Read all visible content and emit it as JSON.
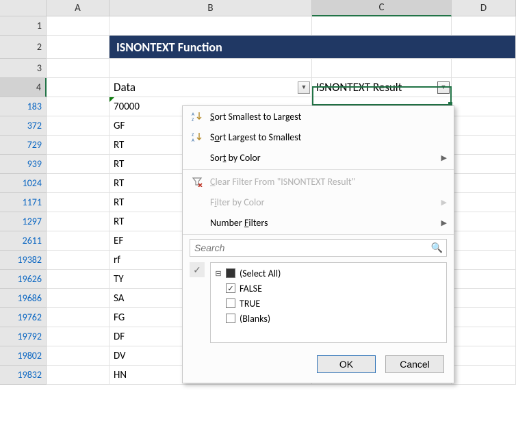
{
  "columns": {
    "A": "A",
    "B": "B",
    "C": "C",
    "D": "D"
  },
  "title_banner": "ISNONTEXT Function",
  "headers": {
    "data": "Data",
    "result": "ISNONTEXT Result"
  },
  "rows": [
    {
      "num": "1"
    },
    {
      "num": "2"
    },
    {
      "num": "3"
    },
    {
      "num": "4"
    },
    {
      "num": "183",
      "data": "70000"
    },
    {
      "num": "372",
      "data": "GF"
    },
    {
      "num": "729",
      "data": "RT"
    },
    {
      "num": "939",
      "data": "RT"
    },
    {
      "num": "1024",
      "data": "RT"
    },
    {
      "num": "1171",
      "data": "RT"
    },
    {
      "num": "1297",
      "data": "RT"
    },
    {
      "num": "2611",
      "data": "EF"
    },
    {
      "num": "19382",
      "data": "rf"
    },
    {
      "num": "19626",
      "data": "TY"
    },
    {
      "num": "19686",
      "data": "SA"
    },
    {
      "num": "19762",
      "data": "FG"
    },
    {
      "num": "19792",
      "data": "DF"
    },
    {
      "num": "19802",
      "data": "DV"
    },
    {
      "num": "19832",
      "data": "HN"
    }
  ],
  "menu": {
    "sort_asc": "Sort Smallest to Largest",
    "sort_desc": "Sort Largest to Smallest",
    "sort_color": "Sort by Color",
    "clear_filter": "Clear Filter From \"ISNONTEXT Result\"",
    "filter_color": "Filter by Color",
    "number_filters": "Number Filters",
    "search_placeholder": "Search",
    "select_all": "(Select All)",
    "opt_false": "FALSE",
    "opt_true": "TRUE",
    "opt_blanks": "(Blanks)",
    "ok": "OK",
    "cancel": "Cancel"
  }
}
